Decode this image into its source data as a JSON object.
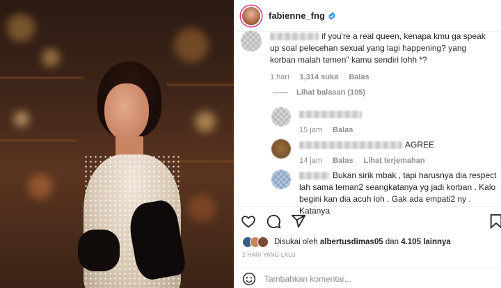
{
  "post": {
    "username": "fabienne_fng",
    "verified": true,
    "accent_verified": "#3897f0",
    "story_ring": "#d62976"
  },
  "comments": [
    {
      "text": "if you're a real queen, kenapa kmu ga speak up soal pelecehan sexual yang lagi happening? yang korban malah temen\" kamu sendiri lohh *?",
      "time": "1 hari",
      "likes": "1,314 suka",
      "reply": "Balas",
      "view_replies": "Lihat balasan (105)"
    },
    {
      "text": "",
      "time": "15 jam",
      "reply": "Balas"
    },
    {
      "text": "AGREE",
      "time": "14 jam",
      "reply": "Balas",
      "translate": "Lihat terjemahan"
    },
    {
      "text": "Bukan sirik mbak , tapi harusnya dia respect lah sama teman2 seangkatanya yg jadi korban . Kalo begini kan dia acuh loh . Gak ada empati2 ny . Katanya"
    }
  ],
  "actions": {
    "like_icon": "heart-icon",
    "comment_icon": "comment-icon",
    "share_icon": "share-icon",
    "save_icon": "bookmark-icon"
  },
  "likes": {
    "prefix": "Disukai oleh ",
    "user": "albertusdimas05",
    "middle": " dan ",
    "count": "4.105 lainnya"
  },
  "date": "2 HARI YANG LALU",
  "add_comment": {
    "placeholder": "Tambahkan komentar...",
    "emoji_icon": "smiley-icon"
  }
}
